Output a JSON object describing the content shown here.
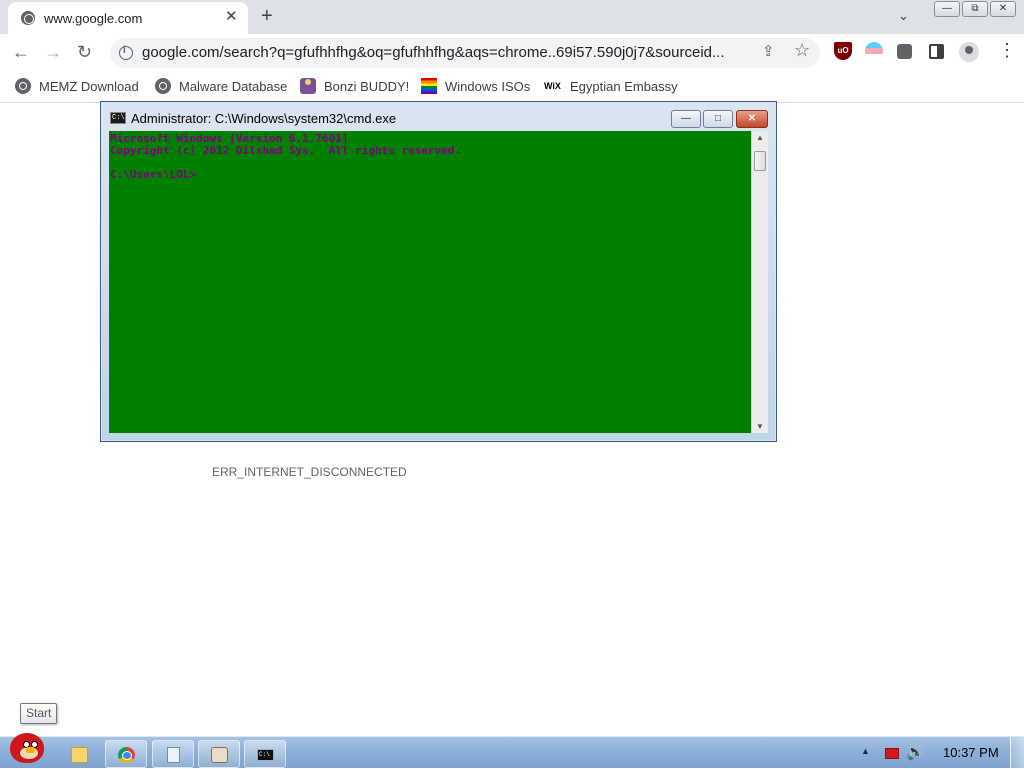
{
  "browser": {
    "tab": {
      "title": "www.google.com",
      "close": "✕"
    },
    "new_tab": "+",
    "tab_dropdown": "⌄",
    "window_buttons": {
      "minimize": "—",
      "restore": "⧉",
      "close": "✕"
    },
    "nav": {
      "back": "←",
      "forward": "→",
      "reload": "↻"
    },
    "address": {
      "url": "google.com/search?q=gfufhhfhg&oq=gfufhhfhg&aqs=chrome..69i57.590j0j7&sourceid...",
      "share": "⇪",
      "star": "☆"
    },
    "extensions": {
      "ublock": "uO"
    },
    "menu": "⋮",
    "bookmarks": [
      {
        "label": "MEMZ Download",
        "icon": "globe-icon"
      },
      {
        "label": "Malware Database",
        "icon": "globe-icon"
      },
      {
        "label": "Bonzi BUDDY!",
        "icon": "bonzi-icon"
      },
      {
        "label": "Windows ISOs",
        "icon": "rainbow-flag-icon"
      },
      {
        "label": "Egyptian Embassy",
        "icon": "wix-icon",
        "icon_text": "WiX"
      }
    ]
  },
  "page": {
    "error_code": "ERR_INTERNET_DISCONNECTED"
  },
  "cmd_window": {
    "title": "Administrator: C:\\Windows\\system32\\cmd.exe",
    "icon_text": "C:\\",
    "buttons": {
      "minimize": "—",
      "maximize": "□",
      "close": "✕"
    },
    "console_text": "Microsoft Windows [Version 6.1.7601]\nCopyright (c) 2012 Dilshad Sys.  All rights reserved.\n\nC:\\Users\\LOL>",
    "colors": {
      "background": "#008000",
      "foreground": "#800080"
    },
    "scroll": {
      "up": "▲",
      "down": "▼"
    }
  },
  "tooltip": {
    "start": "Start"
  },
  "taskbar": {
    "items": [
      "windows-explorer",
      "google-chrome",
      "notepad",
      "paint",
      "command-prompt"
    ],
    "cmd_icon_text": "C:\\",
    "tray": {
      "arrow": "▲",
      "volume": "🔊"
    },
    "clock": "10:37 PM"
  }
}
